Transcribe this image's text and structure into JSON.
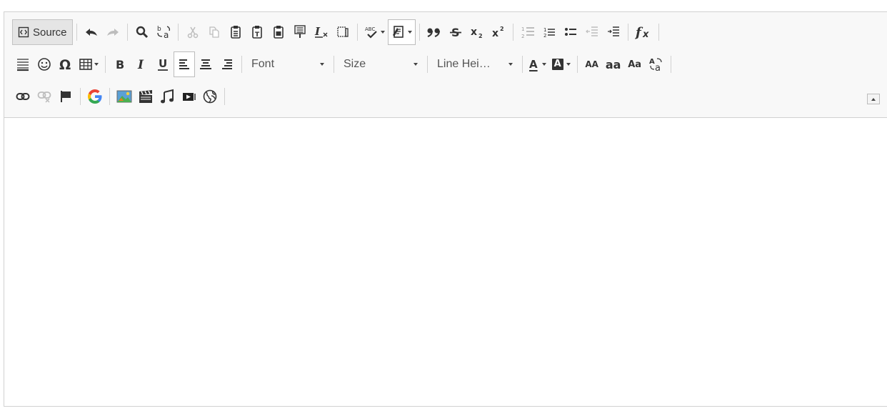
{
  "toolbar": {
    "source_label": "Source",
    "font_combo": "Font",
    "size_combo": "Size",
    "line_height_combo": "Line Hei…",
    "font_color_letter": "A",
    "bg_color_letter": "A",
    "uppercase_text": "AA",
    "lowercase_text": "aa",
    "capitalize_text": "Aa"
  },
  "colors": {
    "toolbar_bg": "#f8f8f8",
    "border": "#d1d1d1",
    "icon": "#333333",
    "google_blue": "#4285F4",
    "google_red": "#EA4335",
    "google_yellow": "#FBBC05",
    "google_green": "#34A853"
  },
  "editor": {
    "content": ""
  }
}
